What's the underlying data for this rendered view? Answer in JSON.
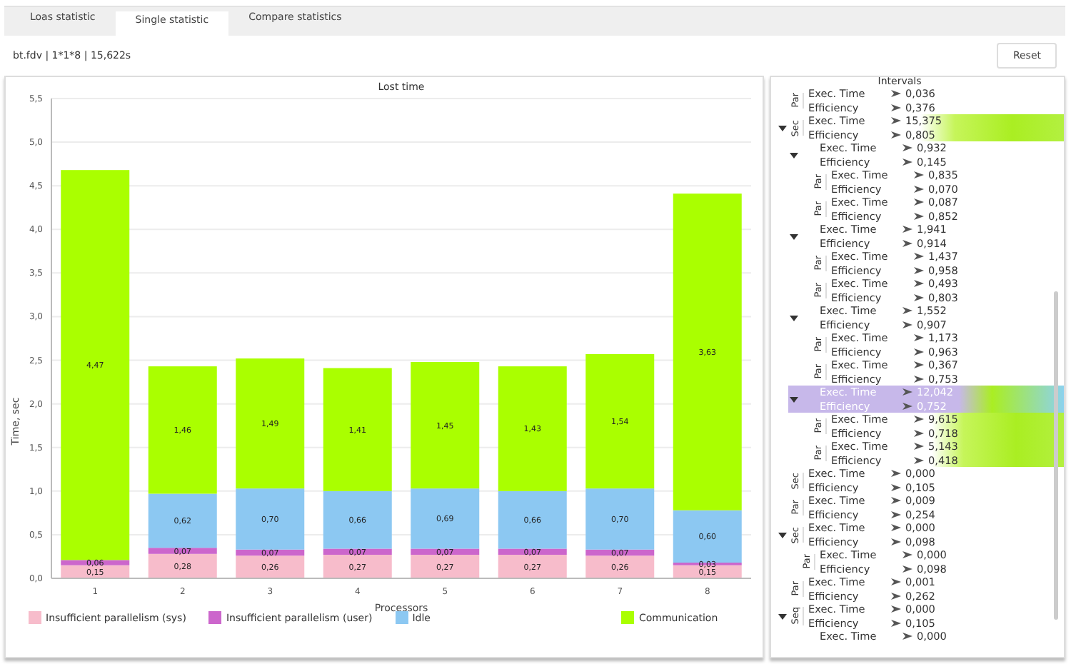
{
  "tabs": [
    {
      "label": "Loas statistic",
      "selected": false
    },
    {
      "label": "Single statistic",
      "selected": true
    },
    {
      "label": "Compare statistics",
      "selected": false
    }
  ],
  "info": "bt.fdv | 1*1*8 | 15,622s",
  "reset_button": "Reset",
  "chart": {
    "chart_data": {
      "type": "bar",
      "title": "Lost time",
      "xlabel": "Processors",
      "ylabel": "Time, sec",
      "stacked": true,
      "grid": true,
      "value_labels": [
        [
          "0,15",
          "0,28",
          "0,26",
          "0,27",
          "0,27",
          "0,27",
          "0,26",
          "0,15"
        ],
        [
          "0,06",
          "0,07",
          "0,07",
          "0,07",
          "0,07",
          "0,07",
          "0,07",
          "0,03"
        ],
        [
          null,
          "0,62",
          "0,70",
          "0,66",
          "0,69",
          "0,66",
          "0,70",
          "0,60"
        ],
        [
          "4,47",
          "1,46",
          "1,49",
          "1,41",
          "1,45",
          "1,43",
          "1,54",
          "3,63"
        ]
      ],
      "categories": [
        "1",
        "2",
        "3",
        "4",
        "5",
        "6",
        "7",
        "8"
      ],
      "ylim": [
        0,
        5.5
      ],
      "yticks": [
        {
          "value": 0,
          "label": "0,0"
        },
        {
          "value": 0.5,
          "label": "0,5"
        },
        {
          "value": 1,
          "label": "1,0"
        },
        {
          "value": 1.5,
          "label": "1,5"
        },
        {
          "value": 2,
          "label": "2,0"
        },
        {
          "value": 2.5,
          "label": "2,5"
        },
        {
          "value": 3,
          "label": "3,0"
        },
        {
          "value": 3.5,
          "label": "3,5"
        },
        {
          "value": 4,
          "label": "4,0"
        },
        {
          "value": 4.5,
          "label": "4,5"
        },
        {
          "value": 5,
          "label": "5,0"
        },
        {
          "value": 5.5,
          "label": "5,5"
        }
      ],
      "series": [
        {
          "name": "Insufficient  parallelism (sys)",
          "color": "#f7bccb",
          "values": [
            0.15,
            0.28,
            0.26,
            0.27,
            0.27,
            0.27,
            0.26,
            0.15
          ]
        },
        {
          "name": "Insufficient  parallelism (user)",
          "color": "#cc66cc",
          "values": [
            0.06,
            0.07,
            0.07,
            0.07,
            0.07,
            0.07,
            0.07,
            0.03
          ]
        },
        {
          "name": "Idle",
          "color": "#8cc8f2",
          "values": [
            null,
            0.62,
            0.7,
            0.66,
            0.69,
            0.66,
            0.7,
            0.6
          ]
        },
        {
          "name": "Communication",
          "color": "#aaff00",
          "values": [
            4.47,
            1.46,
            1.49,
            1.41,
            1.45,
            1.43,
            1.54,
            3.63
          ]
        }
      ]
    }
  },
  "intervals": {
    "title": "Intervals",
    "nodes": [
      {
        "label": "Par",
        "selected": false,
        "hot": false,
        "metrics": [
          {
            "label": "Exec. Time",
            "value": "0,036"
          },
          {
            "label": "Efficiency",
            "value": "0,376"
          }
        ]
      },
      {
        "label": "Sec",
        "selected": false,
        "hot": true,
        "expanded": true,
        "metrics": [
          {
            "label": "Exec. Time",
            "value": "15,375"
          },
          {
            "label": "Efficiency",
            "value": "0,805"
          }
        ],
        "children": [
          {
            "selected": false,
            "hot": false,
            "expanded": true,
            "metrics": [
              {
                "label": "Exec. Time",
                "value": "0,932"
              },
              {
                "label": "Efficiency",
                "value": "0,145"
              }
            ],
            "children": [
              {
                "label": "Par",
                "selected": false,
                "hot": false,
                "metrics": [
                  {
                    "label": "Exec. Time",
                    "value": "0,835"
                  },
                  {
                    "label": "Efficiency",
                    "value": "0,070"
                  }
                ]
              },
              {
                "label": "Par",
                "selected": false,
                "hot": false,
                "metrics": [
                  {
                    "label": "Exec. Time",
                    "value": "0,087"
                  },
                  {
                    "label": "Efficiency",
                    "value": "0,852"
                  }
                ]
              }
            ]
          },
          {
            "selected": false,
            "hot": false,
            "expanded": true,
            "metrics": [
              {
                "label": "Exec. Time",
                "value": "1,941"
              },
              {
                "label": "Efficiency",
                "value": "0,914"
              }
            ],
            "children": [
              {
                "label": "Par",
                "selected": false,
                "hot": false,
                "metrics": [
                  {
                    "label": "Exec. Time",
                    "value": "1,437"
                  },
                  {
                    "label": "Efficiency",
                    "value": "0,958"
                  }
                ]
              },
              {
                "label": "Par",
                "selected": false,
                "hot": false,
                "metrics": [
                  {
                    "label": "Exec. Time",
                    "value": "0,493"
                  },
                  {
                    "label": "Efficiency",
                    "value": "0,803"
                  }
                ]
              }
            ]
          },
          {
            "selected": false,
            "hot": false,
            "expanded": true,
            "metrics": [
              {
                "label": "Exec. Time",
                "value": "1,552"
              },
              {
                "label": "Efficiency",
                "value": "0,907"
              }
            ],
            "children": [
              {
                "label": "Par",
                "selected": false,
                "hot": false,
                "metrics": [
                  {
                    "label": "Exec. Time",
                    "value": "1,173"
                  },
                  {
                    "label": "Efficiency",
                    "value": "0,963"
                  }
                ]
              },
              {
                "label": "Par",
                "selected": false,
                "hot": false,
                "metrics": [
                  {
                    "label": "Exec. Time",
                    "value": "0,367"
                  },
                  {
                    "label": "Efficiency",
                    "value": "0,753"
                  }
                ]
              }
            ]
          },
          {
            "selected": true,
            "hot": true,
            "expanded": true,
            "metrics": [
              {
                "label": "Exec. Time",
                "value": "12,042"
              },
              {
                "label": "Efficiency",
                "value": "0,752"
              }
            ],
            "children": [
              {
                "label": "Par",
                "selected": false,
                "hot": true,
                "metrics": [
                  {
                    "label": "Exec. Time",
                    "value": "9,615"
                  },
                  {
                    "label": "Efficiency",
                    "value": "0,718"
                  }
                ]
              },
              {
                "label": "Par",
                "selected": false,
                "hot": true,
                "metrics": [
                  {
                    "label": "Exec. Time",
                    "value": "5,143"
                  },
                  {
                    "label": "Efficiency",
                    "value": "0,418"
                  }
                ]
              }
            ]
          }
        ]
      },
      {
        "label": "Sec",
        "selected": false,
        "hot": false,
        "metrics": [
          {
            "label": "Exec. Time",
            "value": "0,000"
          },
          {
            "label": "Efficiency",
            "value": "0,105"
          }
        ]
      },
      {
        "label": "Par",
        "selected": false,
        "hot": false,
        "metrics": [
          {
            "label": "Exec. Time",
            "value": "0,009"
          },
          {
            "label": "Efficiency",
            "value": "0,254"
          }
        ]
      },
      {
        "label": "Sec",
        "selected": false,
        "hot": false,
        "expanded": true,
        "metrics": [
          {
            "label": "Exec. Time",
            "value": "0,000"
          },
          {
            "label": "Efficiency",
            "value": "0,098"
          }
        ],
        "children": [
          {
            "label": "Par",
            "selected": false,
            "hot": false,
            "metrics": [
              {
                "label": "Exec. Time",
                "value": "0,000"
              },
              {
                "label": "Efficiency",
                "value": "0,098"
              }
            ]
          }
        ]
      },
      {
        "label": "Par",
        "selected": false,
        "hot": false,
        "metrics": [
          {
            "label": "Exec. Time",
            "value": "0,001"
          },
          {
            "label": "Efficiency",
            "value": "0,262"
          }
        ]
      },
      {
        "label": "Seq",
        "selected": false,
        "hot": false,
        "expanded": true,
        "metrics": [
          {
            "label": "Exec. Time",
            "value": "0,000"
          },
          {
            "label": "Efficiency",
            "value": "0,105"
          }
        ],
        "children": [
          {
            "selected": false,
            "hot": false,
            "metrics": [
              {
                "label": "Exec. Time",
                "value": "0,000"
              }
            ]
          }
        ]
      }
    ]
  }
}
